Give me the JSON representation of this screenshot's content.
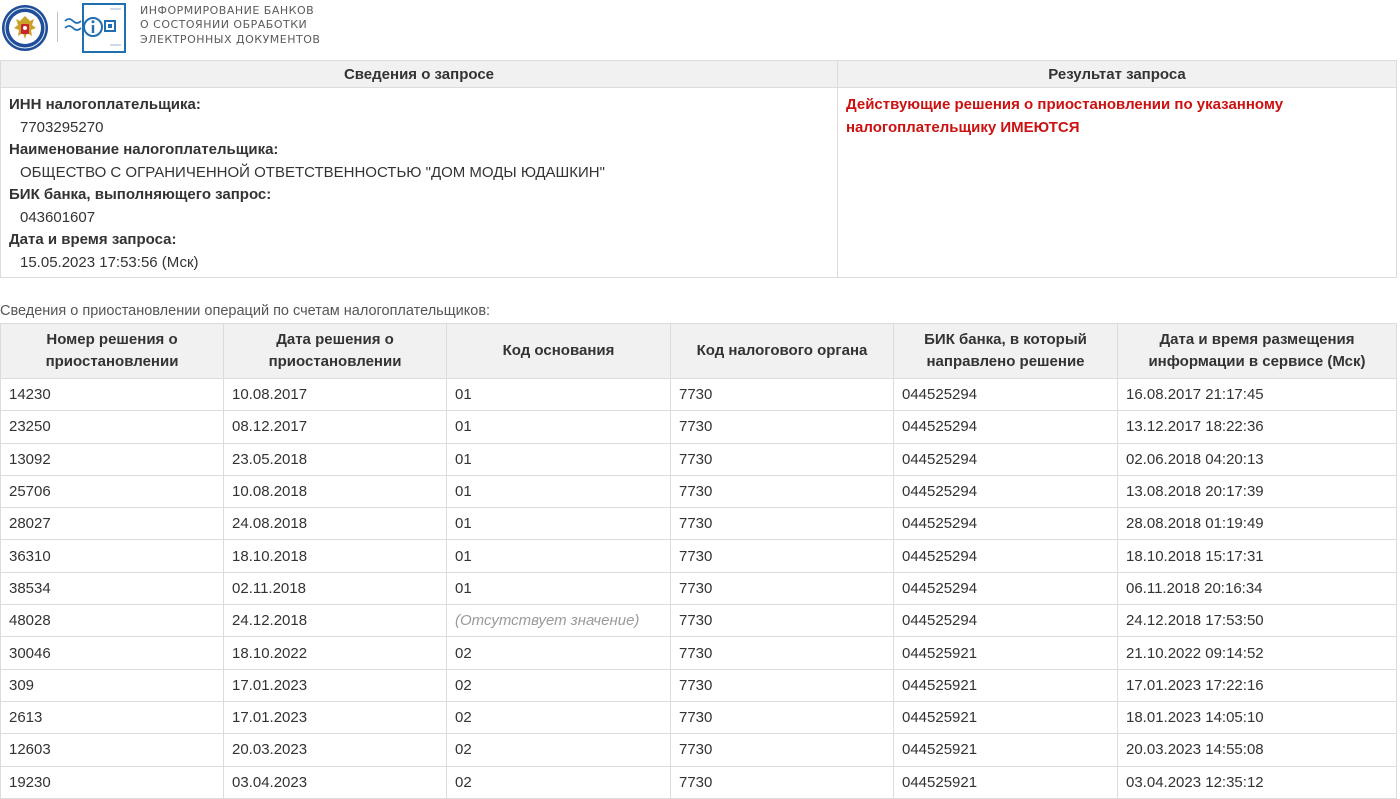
{
  "header": {
    "title_lines": [
      "Информирование банков",
      "о состоянии обработки",
      "электронных документов"
    ]
  },
  "request": {
    "section_title": "Сведения о запросе",
    "result_title": "Результат запроса",
    "inn_label": "ИНН налогоплательщика:",
    "inn_value": "7703295270",
    "name_label": "Наименование налогоплательщика:",
    "name_value": "ОБЩЕСТВО С ОГРАНИЧЕННОЙ ОТВЕТСТВЕННОСТЬЮ \"ДОМ МОДЫ ЮДАШКИН\"",
    "bik_label": "БИК банка, выполняющего запрос:",
    "bik_value": "043601607",
    "datetime_label": "Дата и время запроса:",
    "datetime_value": "15.05.2023 17:53:56 (Мск)",
    "result_text": "Действующие решения о приостановлении по указанному налогоплательщику ИМЕЮТСЯ",
    "result_color": "#cc1111"
  },
  "suspensions": {
    "caption": "Сведения о приостановлении операций по счетам налогоплательщиков:",
    "columns": [
      "Номер решения о приостановлении",
      "Дата решения о приостановлении",
      "Код основания",
      "Код налогового органа",
      "БИК банка, в который направлено решение",
      "Дата и время размещения информации в сервисе (Мск)"
    ],
    "rows": [
      [
        "14230",
        "10.08.2017",
        "01",
        "7730",
        "044525294",
        "16.08.2017 21:17:45"
      ],
      [
        "23250",
        "08.12.2017",
        "01",
        "7730",
        "044525294",
        "13.12.2017 18:22:36"
      ],
      [
        "13092",
        "23.05.2018",
        "01",
        "7730",
        "044525294",
        "02.06.2018 04:20:13"
      ],
      [
        "25706",
        "10.08.2018",
        "01",
        "7730",
        "044525294",
        "13.08.2018 20:17:39"
      ],
      [
        "28027",
        "24.08.2018",
        "01",
        "7730",
        "044525294",
        "28.08.2018 01:19:49"
      ],
      [
        "36310",
        "18.10.2018",
        "01",
        "7730",
        "044525294",
        "18.10.2018 15:17:31"
      ],
      [
        "38534",
        "02.11.2018",
        "01",
        "7730",
        "044525294",
        "06.11.2018 20:16:34"
      ],
      [
        "48028",
        "24.12.2018",
        "(Отсутствует значение)",
        "7730",
        "044525294",
        "24.12.2018 17:53:50"
      ],
      [
        "30046",
        "18.10.2022",
        "02",
        "7730",
        "044525921",
        "21.10.2022 09:14:52"
      ],
      [
        "309",
        "17.01.2023",
        "02",
        "7730",
        "044525921",
        "17.01.2023 17:22:16"
      ],
      [
        "2613",
        "17.01.2023",
        "02",
        "7730",
        "044525921",
        "18.01.2023 14:05:10"
      ],
      [
        "12603",
        "20.03.2023",
        "02",
        "7730",
        "044525921",
        "20.03.2023 14:55:08"
      ],
      [
        "19230",
        "03.04.2023",
        "02",
        "7730",
        "044525921",
        "03.04.2023 12:35:12"
      ]
    ],
    "missing_value_text": "(Отсутствует значение)"
  }
}
